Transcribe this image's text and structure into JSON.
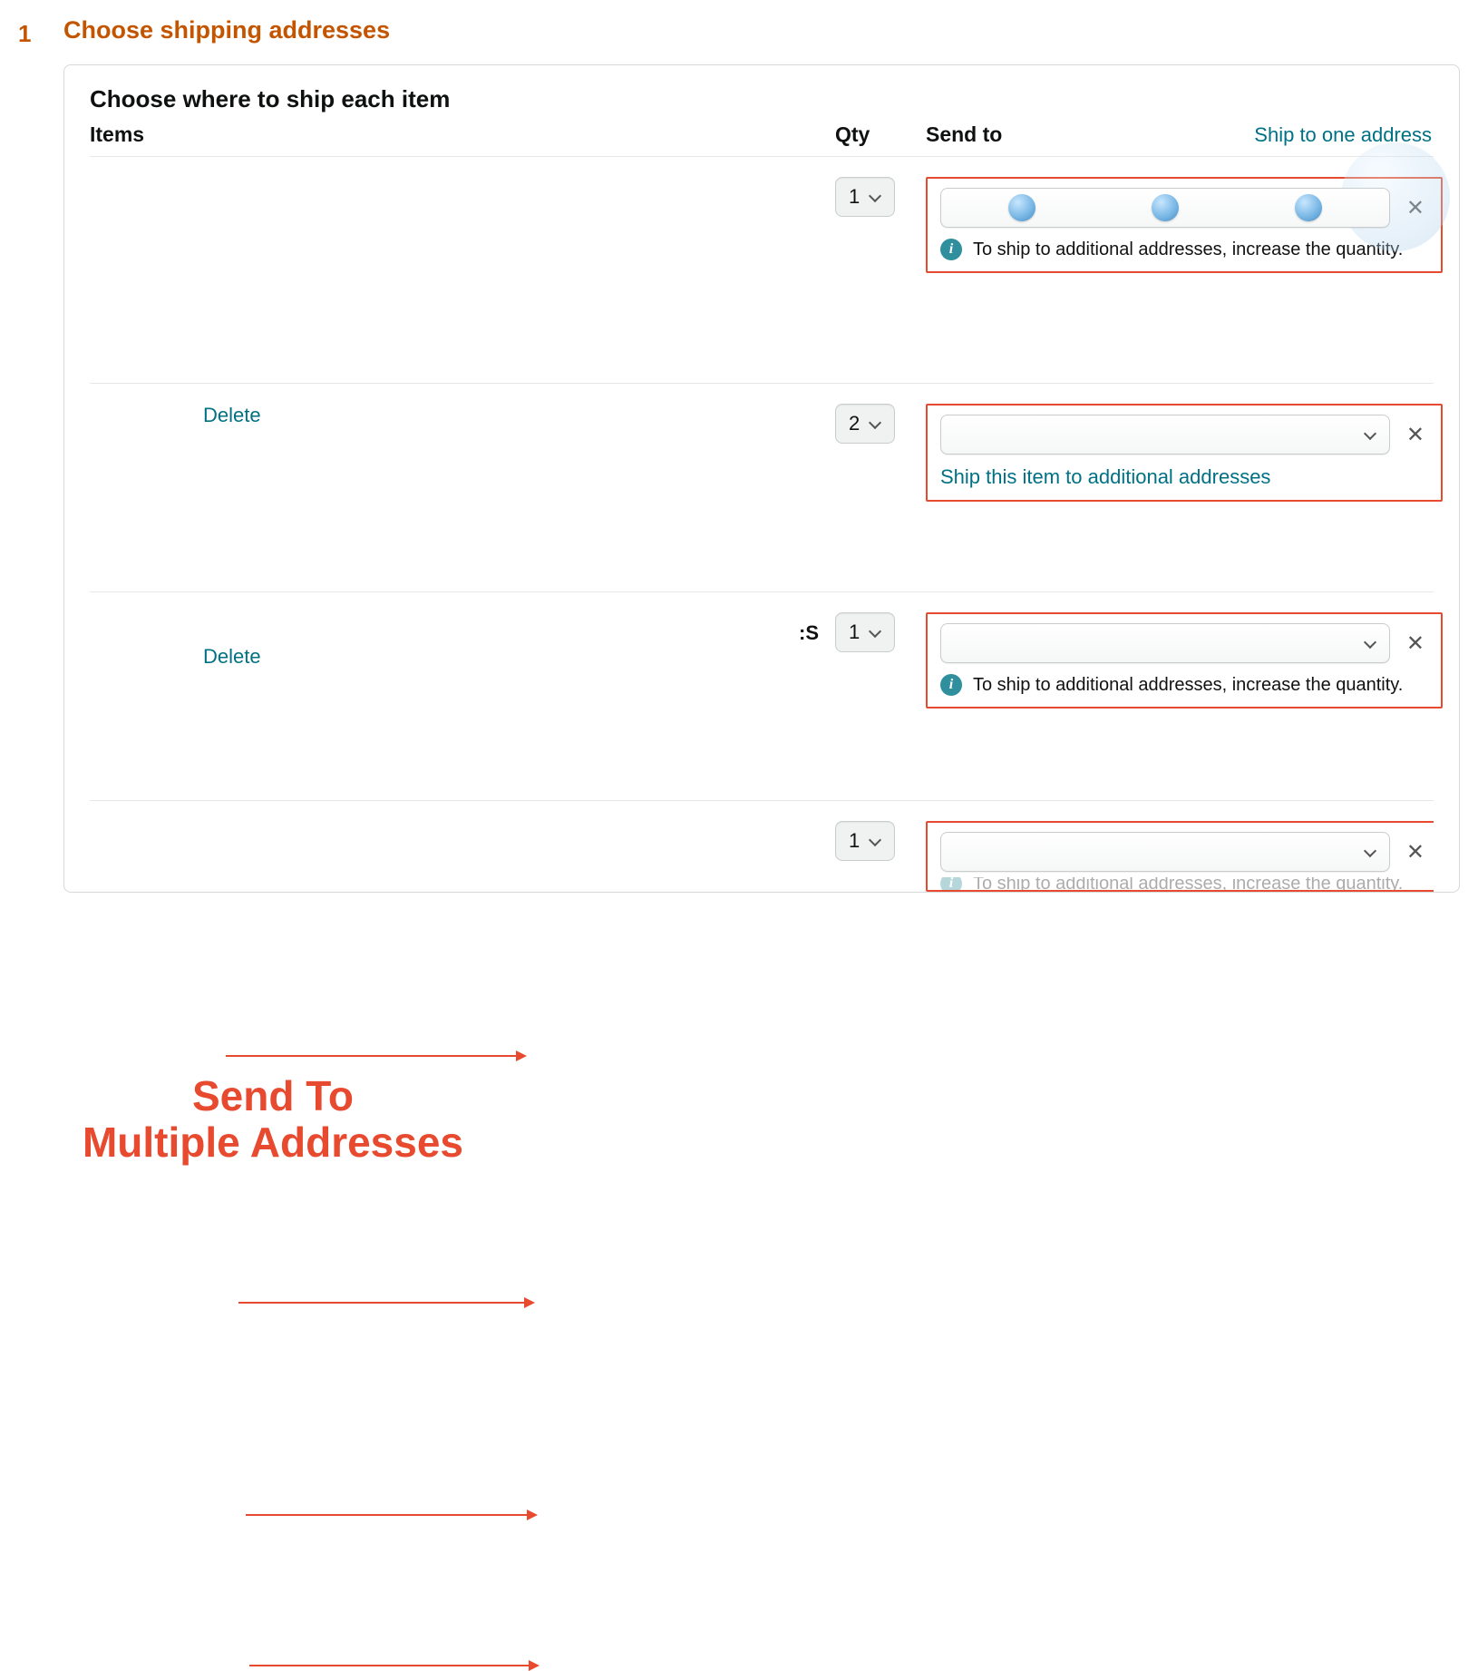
{
  "step": {
    "number": "1",
    "title": "Choose shipping addresses"
  },
  "panel": {
    "title": "Choose where to ship each item",
    "headers": {
      "items": "Items",
      "qty": "Qty",
      "sendto": "Send to"
    },
    "ship_one_link": "Ship to one address",
    "info_message": "To ship to additional addresses, increase the quantity.",
    "ship_additional_link": "Ship this item to additional addresses"
  },
  "actions": {
    "delete": "Delete"
  },
  "annotation": {
    "title_line1": "Send To",
    "title_line2": "Multiple Addresses"
  },
  "rows": [
    {
      "qty": "1",
      "show_info": true,
      "show_additional_link": false,
      "stub": ""
    },
    {
      "qty": "2",
      "show_info": false,
      "show_additional_link": true,
      "stub": ""
    },
    {
      "qty": "1",
      "show_info": true,
      "show_additional_link": false,
      "stub": ":S"
    },
    {
      "qty": "1",
      "show_info": true,
      "show_additional_link": false,
      "stub": ""
    }
  ]
}
